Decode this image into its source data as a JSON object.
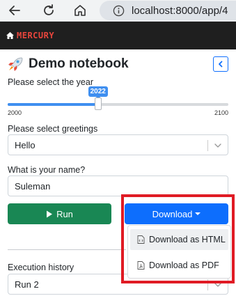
{
  "browser": {
    "url": "localhost:8000/app/4"
  },
  "app": {
    "brand": "MERCURY"
  },
  "notebook": {
    "title": "Demo notebook"
  },
  "year_slider": {
    "label": "Please select the year",
    "value": 2022,
    "value_label": "2022",
    "min": 2000,
    "max": 2100,
    "min_label": "2000",
    "max_label": "2100"
  },
  "greetings": {
    "label": "Please select greetings",
    "selected": "Hello"
  },
  "name": {
    "label": "What is your name?",
    "value": "Suleman"
  },
  "buttons": {
    "run": "Run",
    "download": "Download"
  },
  "download_menu": {
    "items": [
      {
        "label": "Download as HTML",
        "icon": "file-code-icon"
      },
      {
        "label": "Download as PDF",
        "icon": "file-pdf-icon"
      }
    ]
  },
  "history": {
    "label": "Execution history",
    "selected": "Run 2"
  },
  "colors": {
    "accent": "#0d6efd",
    "run": "#198754",
    "brand": "#e8453c",
    "highlight": "#e01b24"
  }
}
